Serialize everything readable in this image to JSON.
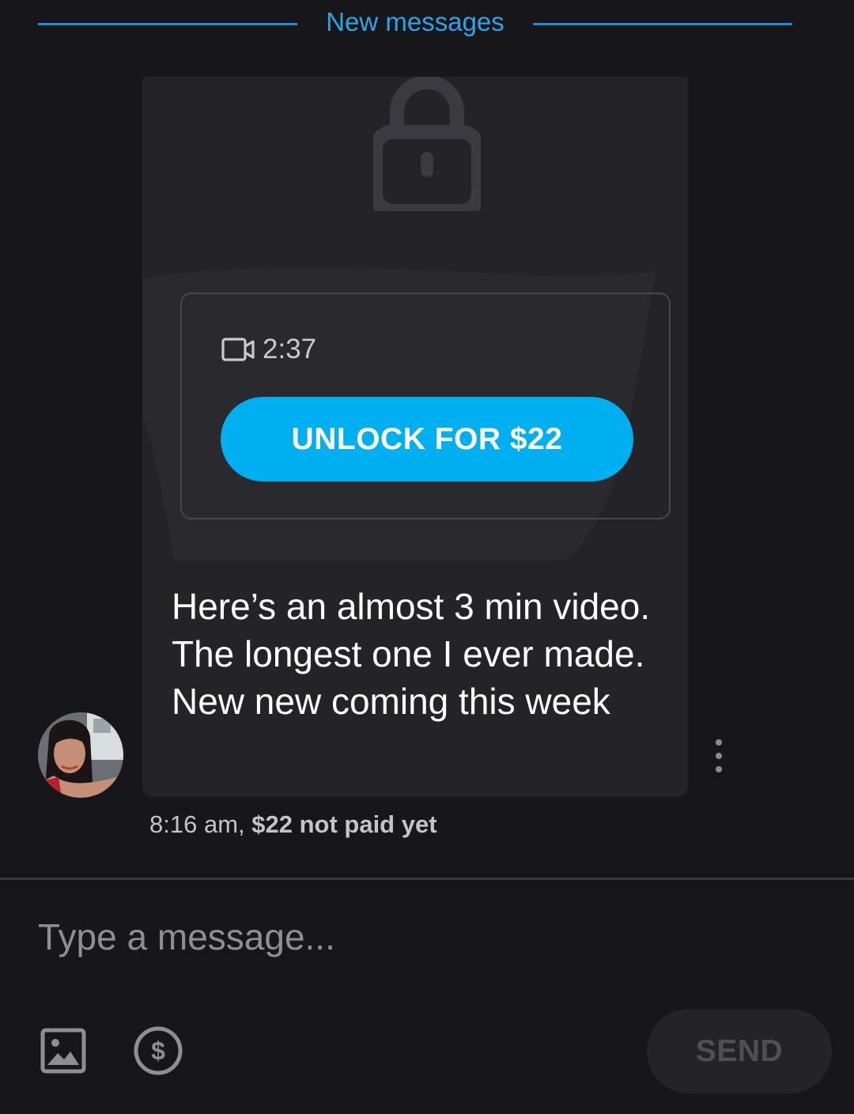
{
  "divider": {
    "label": "New messages",
    "color": "#2ea4e6"
  },
  "message": {
    "locked_media": {
      "icon": "lock-icon",
      "media_icon": "video-camera-icon",
      "duration": "2:37",
      "unlock_label": "UNLOCK FOR $22",
      "unlock_color": "#00aff0"
    },
    "text": "Here’s an almost 3 min video. The longest one I ever made. New new coming this week",
    "time": "8:16 am,",
    "payment_status": "$22 not paid yet",
    "more_icon": "more-vertical-icon"
  },
  "composer": {
    "placeholder": "Type a message...",
    "image_icon": "image-icon",
    "tip_icon": "dollar-circle-icon",
    "send_label": "SEND"
  },
  "colors": {
    "background": "#17171b",
    "bubble": "#242428",
    "accent": "#00aff0"
  }
}
